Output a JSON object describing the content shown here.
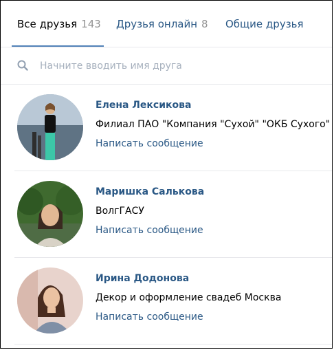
{
  "tabs": [
    {
      "label": "Все друзья",
      "count": "143",
      "active": true
    },
    {
      "label": "Друзья онлайн",
      "count": "8",
      "active": false
    },
    {
      "label": "Общие друзья",
      "count": "",
      "active": false
    }
  ],
  "search": {
    "placeholder": "Начните вводить имя друга",
    "icon": "search-icon"
  },
  "friends": [
    {
      "name": "Елена Лексикова",
      "info": "Филиал ПАО \"Компания \"Сухой\" \"ОКБ Сухого\"",
      "action": "Написать сообщение"
    },
    {
      "name": "Маришка Салькова",
      "info": "ВолгГАСУ",
      "action": "Написать сообщение"
    },
    {
      "name": "Ирина Додонова",
      "info": "Декор и оформление свадеб Москва",
      "action": "Написать сообщение"
    }
  ],
  "colors": {
    "link": "#2a5885",
    "accent": "#5181b8",
    "muted": "#939393",
    "divider": "#e7e8ec"
  }
}
